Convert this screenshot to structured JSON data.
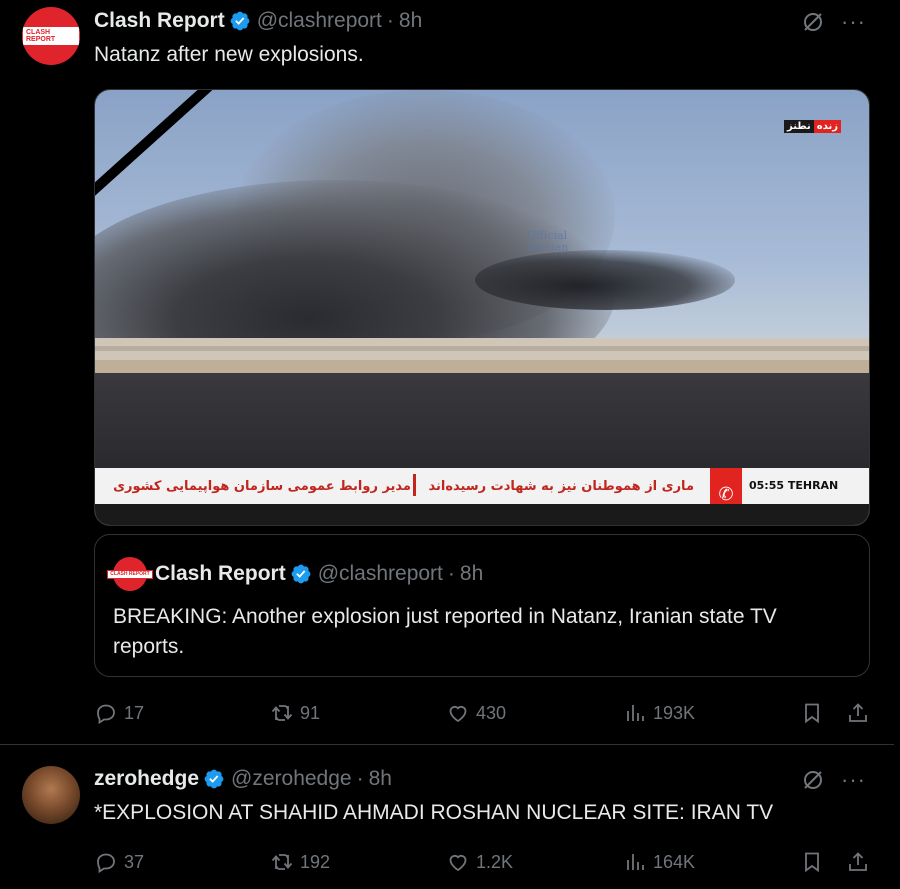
{
  "tweets": [
    {
      "author": {
        "name": "Clash Report",
        "handle": "@clashreport",
        "time": "8h",
        "avatar_text": "CLASH REPORT"
      },
      "text": "Natanz after new explosions.",
      "media": {
        "live_badge_left": "نطنز",
        "live_badge_right": "زنده",
        "watermark_line1": "Official",
        "watermark_line2": "Persian",
        "ticker_left": "مدیر روابط عمومی سازمان هواپیمایی کشوری",
        "ticker_right": "ماری از هموطنان نیز به شهادت رسیده‌اند",
        "clock": "05:55  TEHRAN"
      },
      "quote": {
        "author": {
          "name": "Clash Report",
          "handle": "@clashreport",
          "time": "8h"
        },
        "text": "BREAKING: Another explosion just reported in Natanz, Iranian state TV reports."
      },
      "stats": {
        "replies": "17",
        "retweets": "91",
        "likes": "430",
        "views": "193K"
      }
    },
    {
      "author": {
        "name": "zerohedge",
        "handle": "@zerohedge",
        "time": "8h"
      },
      "text": "*EXPLOSION AT SHAHID AHMADI ROSHAN NUCLEAR SITE: IRAN TV",
      "stats": {
        "replies": "37",
        "retweets": "192",
        "likes": "1.2K",
        "views": "164K"
      }
    }
  ],
  "colors": {
    "background": "#000000",
    "text": "#e7e9ea",
    "muted": "#71767b",
    "verified": "#1d9bf0",
    "border": "#2f3336"
  },
  "icons": [
    "verified-badge-icon",
    "grok-icon",
    "more-icon",
    "reply-icon",
    "retweet-icon",
    "like-icon",
    "views-icon",
    "bookmark-icon",
    "share-icon"
  ]
}
